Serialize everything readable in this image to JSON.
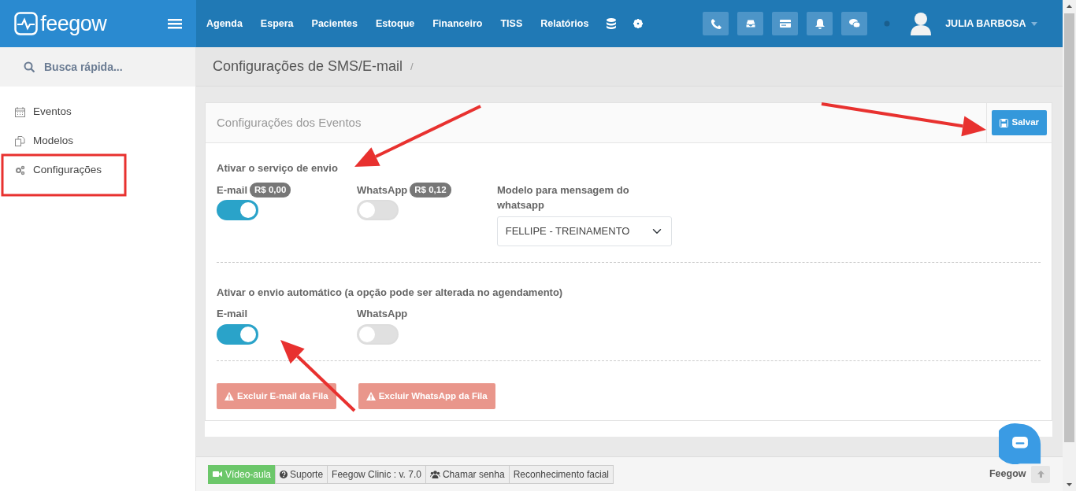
{
  "navbar": {
    "logo": "feegow",
    "menu": [
      "Agenda",
      "Espera",
      "Pacientes",
      "Estoque",
      "Financeiro",
      "TISS",
      "Relatórios"
    ],
    "user": "JULIA BARBOSA"
  },
  "sidebar": {
    "search": "Busca rápida...",
    "items": [
      {
        "label": "Eventos",
        "kind": "calendar"
      },
      {
        "label": "Modelos",
        "kind": "copy"
      },
      {
        "label": "Configurações",
        "kind": "gears"
      }
    ]
  },
  "breadcrumb": {
    "title": "Configurações de SMS/E-mail",
    "separator": "/"
  },
  "panel": {
    "title": "Configurações dos Eventos",
    "save_button": "Salvar",
    "sections": [
      {
        "heading": "Ativar o serviço de envio",
        "toggles": [
          {
            "label": "E-mail",
            "price": "R$ 0,00",
            "on": true
          },
          {
            "label": "WhatsApp",
            "price": "R$ 0,12",
            "on": false
          }
        ],
        "select": {
          "label": "Modelo para mensagem do whatsapp",
          "value": "FELLIPE - TREINAMENTO"
        }
      },
      {
        "heading": "Ativar o envio automático (a opção pode ser alterada no agendamento)",
        "toggles": [
          {
            "label": "E-mail",
            "on": true
          },
          {
            "label": "WhatsApp",
            "on": false
          }
        ]
      }
    ],
    "actions": [
      "Excluir E-mail da Fila",
      "Excluir WhatsApp da Fila"
    ]
  },
  "footer": {
    "links": [
      {
        "label": "Vídeo-aula",
        "kind": "video"
      },
      {
        "label": "Suporte",
        "kind": "help"
      },
      {
        "label": "Feegow Clinic : v. 7.0",
        "kind": "plain"
      },
      {
        "label": "Chamar senha",
        "kind": "users"
      },
      {
        "label": "Reconhecimento facial",
        "kind": "plain"
      }
    ],
    "brand": "Feegow"
  }
}
